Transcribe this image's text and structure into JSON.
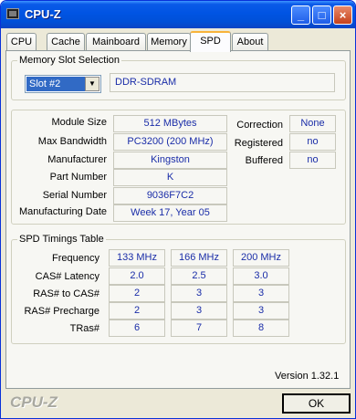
{
  "window": {
    "title": "CPU-Z",
    "min": "_",
    "max": "□",
    "close": "×"
  },
  "tabs": [
    "CPU",
    "Cache",
    "Mainboard",
    "Memory",
    "SPD",
    "About"
  ],
  "slot_selection": {
    "title": "Memory Slot Selection",
    "slot": "Slot #2",
    "type": "DDR-SDRAM"
  },
  "module": {
    "labels": [
      "Module Size",
      "Max Bandwidth",
      "Manufacturer",
      "Part Number",
      "Serial Number",
      "Manufacturing Date"
    ],
    "values": [
      "512 MBytes",
      "PC3200 (200 MHz)",
      "Kingston",
      "K",
      "9036F7C2",
      "Week 17, Year 05"
    ],
    "side_labels": [
      "Correction",
      "Registered",
      "Buffered"
    ],
    "side_values": [
      "None",
      "no",
      "no"
    ]
  },
  "timings": {
    "title": "SPD Timings Table",
    "row_labels": [
      "Frequency",
      "CAS# Latency",
      "RAS# to CAS#",
      "RAS# Precharge",
      "TRas#"
    ],
    "rows": [
      [
        "133 MHz",
        "166 MHz",
        "200 MHz"
      ],
      [
        "2.0",
        "2.5",
        "3.0"
      ],
      [
        "2",
        "3",
        "3"
      ],
      [
        "2",
        "3",
        "3"
      ],
      [
        "6",
        "7",
        "8"
      ]
    ]
  },
  "footer": {
    "version": "Version 1.32.1",
    "brand": "CPU-Z",
    "ok": "OK"
  }
}
